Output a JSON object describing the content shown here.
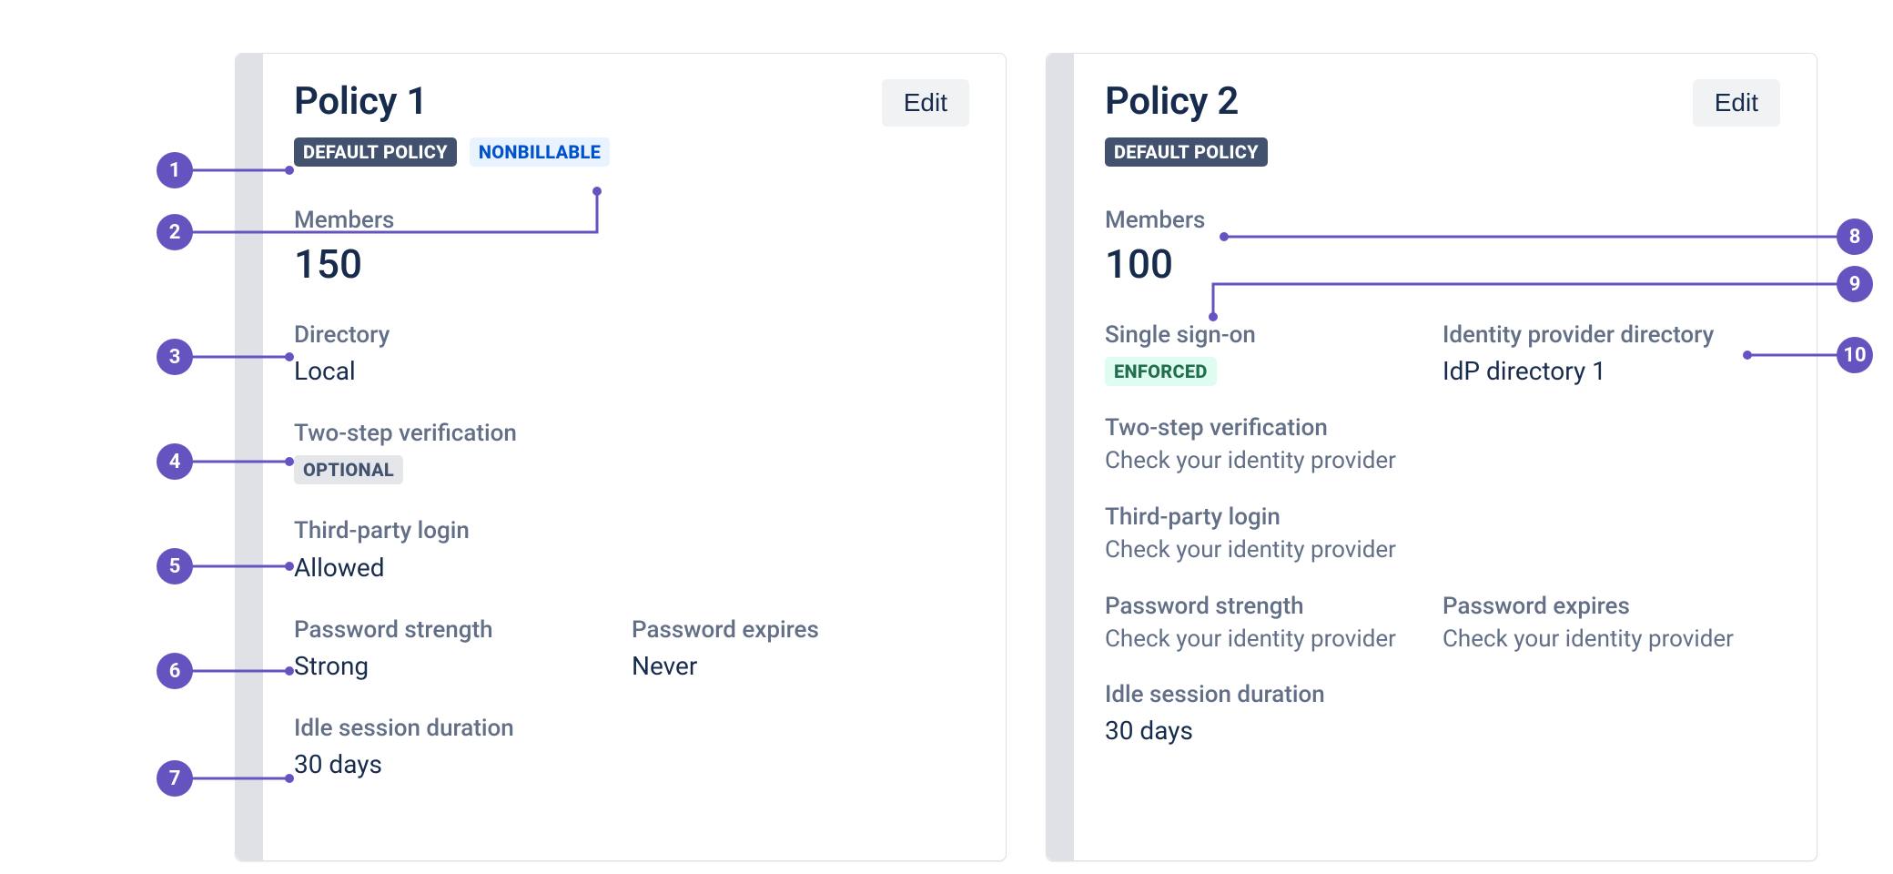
{
  "policy1": {
    "title": "Policy 1",
    "edit_label": "Edit",
    "badges": {
      "default": "DEFAULT POLICY",
      "nonbillable": "NONBILLABLE"
    },
    "members_label": "Members",
    "members_value": "150",
    "directory_label": "Directory",
    "directory_value": "Local",
    "twostep_label": "Two-step verification",
    "twostep_badge": "OPTIONAL",
    "thirdparty_label": "Third-party login",
    "thirdparty_value": "Allowed",
    "pw_strength_label": "Password strength",
    "pw_strength_value": "Strong",
    "pw_expires_label": "Password expires",
    "pw_expires_value": "Never",
    "idle_label": "Idle session duration",
    "idle_value": "30 days"
  },
  "policy2": {
    "title": "Policy 2",
    "edit_label": "Edit",
    "badges": {
      "default": "DEFAULT POLICY"
    },
    "members_label": "Members",
    "members_value": "100",
    "sso_label": "Single sign-on",
    "sso_badge": "ENFORCED",
    "idp_label": "Identity provider directory",
    "idp_value": "IdP directory 1",
    "twostep_label": "Two-step verification",
    "twostep_value": "Check your identity provider",
    "thirdparty_label": "Third-party login",
    "thirdparty_value": "Check your identity provider",
    "pw_strength_label": "Password strength",
    "pw_strength_value": "Check your identity provider",
    "pw_expires_label": "Password expires",
    "pw_expires_value": "Check your identity provider",
    "idle_label": "Idle session duration",
    "idle_value": "30 days"
  },
  "annotations": {
    "a1": "1",
    "a2": "2",
    "a3": "3",
    "a4": "4",
    "a5": "5",
    "a6": "6",
    "a7": "7",
    "a8": "8",
    "a9": "9",
    "a10": "10"
  }
}
